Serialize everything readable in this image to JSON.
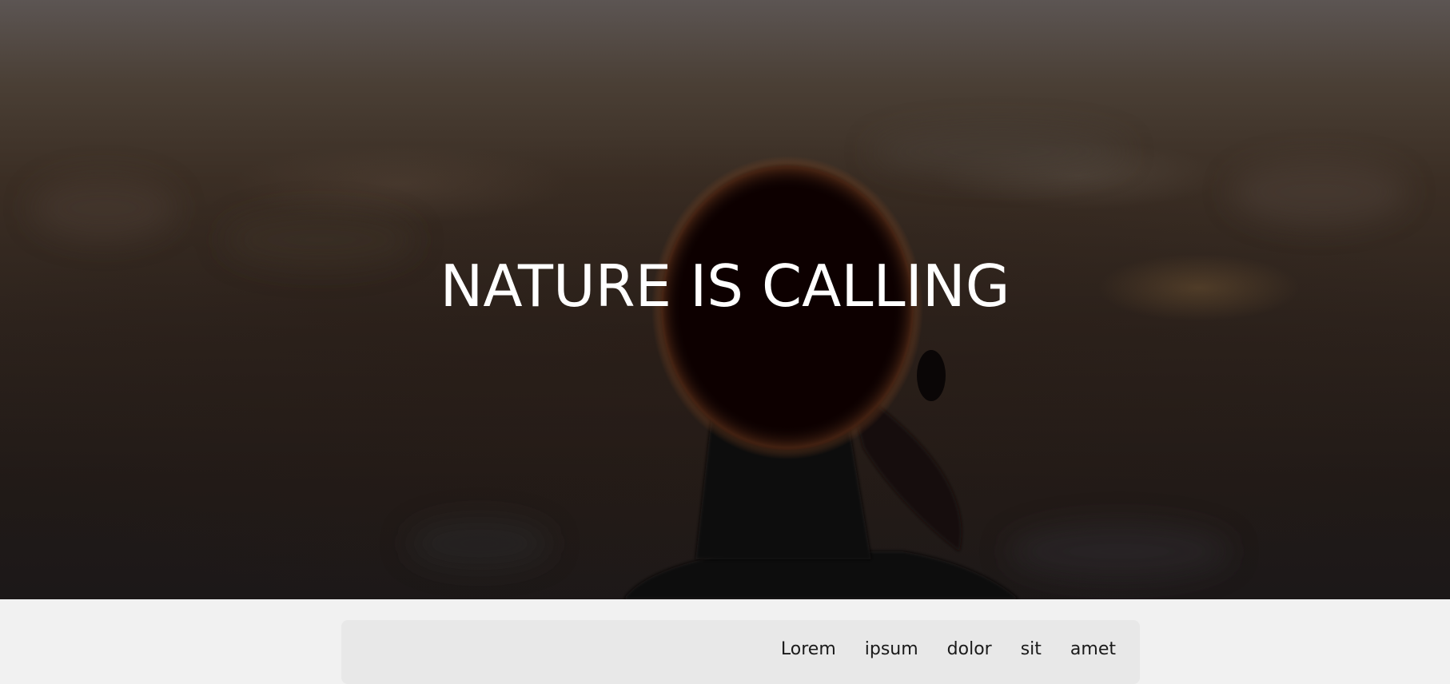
{
  "hero": {
    "title": "NATURE IS CALLING",
    "image_subject": "silhouette of a person with hair in a bun against a blurred dusk landscape"
  },
  "content": {
    "words": [
      "Lorem",
      "ipsum",
      "dolor",
      "sit",
      "amet"
    ]
  },
  "colors": {
    "hero_overlay": "#2a201b",
    "page_background": "#f1f1f1",
    "card_background": "#e8e8e8",
    "title_color": "#ffffff",
    "text_color": "#1a1a1a"
  }
}
